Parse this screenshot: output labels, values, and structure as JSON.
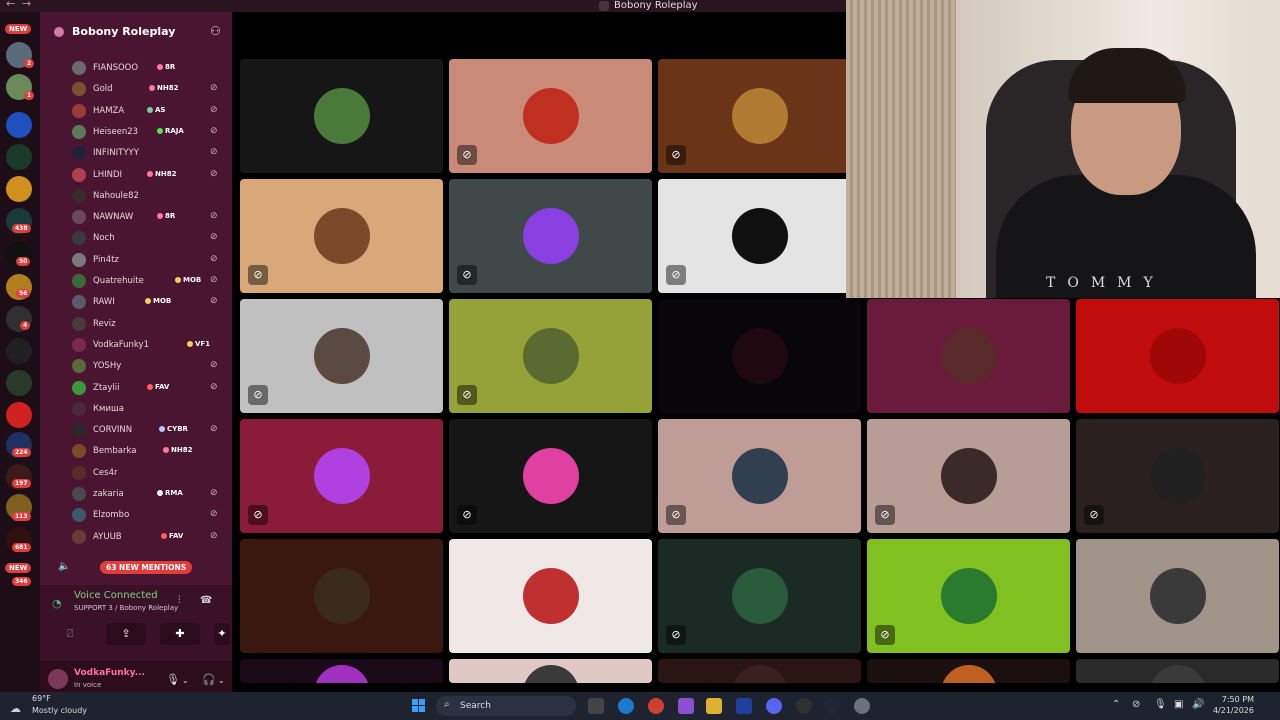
{
  "window": {
    "title": "Bobony Roleplay"
  },
  "server": {
    "name": "Bobony Roleplay"
  },
  "rail": {
    "new_top": "NEW",
    "new_bottom": "NEW",
    "badges": [
      "2",
      "1",
      "438",
      "50",
      "56",
      "4",
      "224",
      "197",
      "113",
      "681",
      "346"
    ]
  },
  "members": [
    {
      "name": "FIANSOOO",
      "tag": "8R",
      "tag_color": "#ff7aa0"
    },
    {
      "name": "Gold",
      "tag": "NH82",
      "tag_color": "#ff7aa0"
    },
    {
      "name": "HAMZA",
      "tag": "AS",
      "tag_color": "#7fd0a0"
    },
    {
      "name": "Heiseen23",
      "tag": "RAJA",
      "tag_color": "#55e055"
    },
    {
      "name": "INFINITYYY",
      "tag": "",
      "tag_color": "#ff7aa0"
    },
    {
      "name": "LHINDI",
      "tag": "NH82",
      "tag_color": "#ff7aa0"
    },
    {
      "name": "Nahoule82",
      "tag": "",
      "tag_color": "#ffffff"
    },
    {
      "name": "NAWNAW",
      "tag": "8R",
      "tag_color": "#ff7aa0"
    },
    {
      "name": "Noch",
      "tag": "",
      "tag_color": "#ffffff"
    },
    {
      "name": "Pin4tz",
      "tag": "",
      "tag_color": "#ffffff"
    },
    {
      "name": "Quatrehuite",
      "tag": "MOB",
      "tag_color": "#f0d060"
    },
    {
      "name": "RAWI",
      "tag": "MOB",
      "tag_color": "#f0d060"
    },
    {
      "name": "Reviz",
      "tag": "",
      "tag_color": "#ffffff"
    },
    {
      "name": "VodkaFunky1",
      "tag": "VF1",
      "tag_color": "#f0d060"
    },
    {
      "name": "YOSHy",
      "tag": "",
      "tag_color": "#ffffff"
    },
    {
      "name": "Ztaylii",
      "tag": "FAV",
      "tag_color": "#ff6060"
    },
    {
      "name": "Кмиша",
      "tag": "",
      "tag_color": "#ffffff"
    },
    {
      "name": "CORVINN",
      "tag": "CYBR",
      "tag_color": "#c0c0ff"
    },
    {
      "name": "Bembarka",
      "tag": "NH82",
      "tag_color": "#ff7aa0"
    },
    {
      "name": "Ces4r",
      "tag": "",
      "tag_color": "#ffffff"
    },
    {
      "name": "zakaria",
      "tag": "RMA",
      "tag_color": "#ffffff"
    },
    {
      "name": "Elzombo",
      "tag": "",
      "tag_color": "#ffffff"
    },
    {
      "name": "AYUUB",
      "tag": "FAV",
      "tag_color": "#ff6060"
    }
  ],
  "mentions": "63 NEW MENTIONS",
  "voice": {
    "status": "Voice Connected",
    "channel": "SUPPORT 3 / Bobony Roleplay"
  },
  "user": {
    "name": "VodkaFunky...",
    "status": "In voice"
  },
  "cam": {
    "shirt_text": "TOMMY"
  },
  "taskbar": {
    "temp": "69°F",
    "weather": "Mostly cloudy",
    "search": "Search",
    "time": "7:50 PM",
    "date": "4/21/2026"
  },
  "colors": {
    "sidebar": "#4a1530",
    "accent_red": "#e23d3d",
    "voice_green": "#7fd08a"
  }
}
